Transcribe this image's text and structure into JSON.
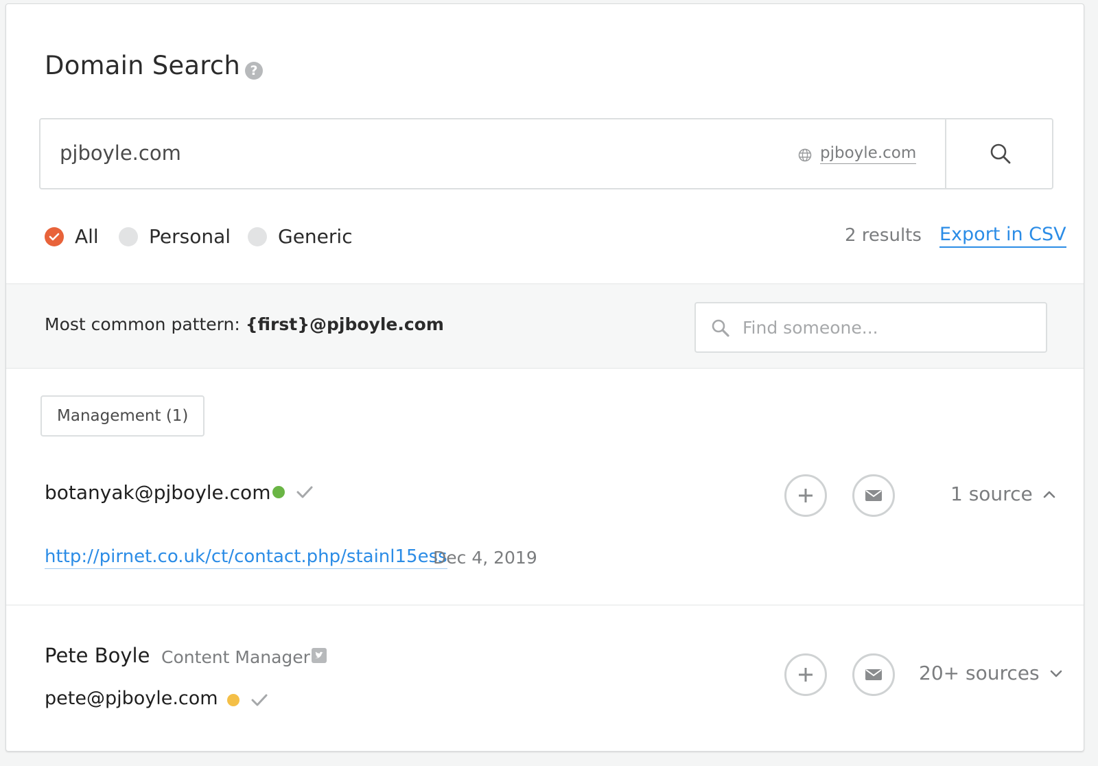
{
  "header": {
    "title": "Domain Search",
    "help_icon": "question-circle-icon"
  },
  "search": {
    "value": "pjboyle.com",
    "domain_chip": "pjboyle.com",
    "globe_icon": "globe-icon",
    "button_icon": "search-icon"
  },
  "filters": {
    "options": [
      {
        "label": "All",
        "selected": true
      },
      {
        "label": "Personal",
        "selected": false
      },
      {
        "label": "Generic",
        "selected": false
      }
    ],
    "results_count": "2 results",
    "export_label": "Export in CSV"
  },
  "pattern": {
    "label": "Most common pattern:",
    "value": "{first}@pjboyle.com",
    "find_placeholder": "Find someone..."
  },
  "department": {
    "label": "Management (1)"
  },
  "results": [
    {
      "email": "botanyak@pjboyle.com",
      "confidence_color": "#6ab545",
      "verified": true,
      "sources_label": "1 source",
      "expanded": true,
      "source_url": "http://pirnet.co.uk/ct/contact.php/stainl15ess",
      "source_date": "Dec 4, 2019"
    },
    {
      "name": "Pete Boyle",
      "position": "Content Manager",
      "twitter_icon": "twitter-icon",
      "email": "pete@pjboyle.com",
      "confidence_color": "#f4bf47",
      "verified": true,
      "sources_label": "20+ sources",
      "expanded": false
    }
  ],
  "colors": {
    "accent": "#e8633a",
    "link": "#2b8ce6",
    "muted": "#7b7d7f"
  }
}
